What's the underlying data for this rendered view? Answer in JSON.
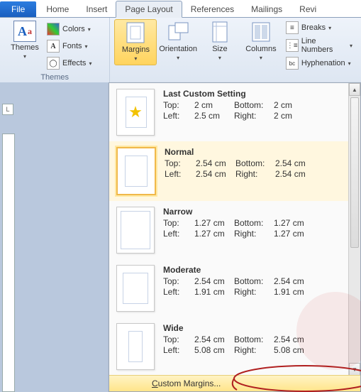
{
  "tabs": {
    "file": "File",
    "home": "Home",
    "insert": "Insert",
    "page_layout": "Page Layout",
    "references": "References",
    "mailings": "Mailings",
    "review": "Revi"
  },
  "ribbon": {
    "themes_group": "Themes",
    "themes_btn": "Themes",
    "colors": "Colors",
    "fonts": "Fonts",
    "effects": "Effects",
    "margins": "Margins",
    "orientation": "Orientation",
    "size": "Size",
    "columns": "Columns",
    "breaks": "Breaks",
    "line_numbers": "Line Numbers",
    "hyphenation": "Hyphenation"
  },
  "presets": [
    {
      "name": "Last Custom Setting",
      "top": "2 cm",
      "bottom": "2 cm",
      "left": "2.5 cm",
      "right": "2 cm",
      "star": true,
      "m": [
        10,
        10,
        12,
        10
      ]
    },
    {
      "name": "Normal",
      "top": "2.54 cm",
      "bottom": "2.54 cm",
      "left": "2.54 cm",
      "right": "2.54 cm",
      "selected": true,
      "m": [
        10,
        10,
        10,
        10
      ]
    },
    {
      "name": "Narrow",
      "top": "1.27 cm",
      "bottom": "1.27 cm",
      "left": "1.27 cm",
      "right": "1.27 cm",
      "m": [
        5,
        5,
        5,
        5
      ]
    },
    {
      "name": "Moderate",
      "top": "2.54 cm",
      "bottom": "2.54 cm",
      "left": "1.91 cm",
      "right": "1.91 cm",
      "m": [
        10,
        10,
        8,
        8
      ]
    },
    {
      "name": "Wide",
      "top": "2.54 cm",
      "bottom": "2.54 cm",
      "left": "5.08 cm",
      "right": "5.08 cm",
      "m": [
        10,
        10,
        16,
        16
      ]
    }
  ],
  "labels": {
    "top": "Top:",
    "bottom": "Bottom:",
    "left": "Left:",
    "right": "Right:"
  },
  "footer": {
    "c": "C",
    "rest": "ustom Margins..."
  },
  "ruler": "L"
}
